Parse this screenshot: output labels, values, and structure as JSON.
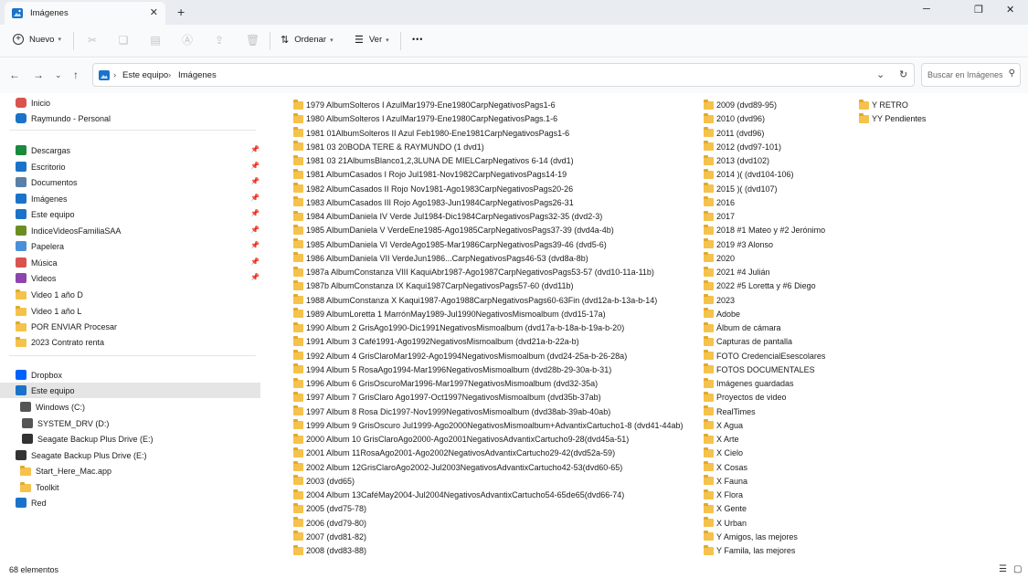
{
  "window": {
    "tab_title": "Imágenes",
    "tab_close": "✕",
    "new_tab": "+",
    "minimize": "─",
    "maximize": "❐",
    "close": "✕"
  },
  "toolbar": {
    "new_label": "Nuevo",
    "sort_label": "Ordenar",
    "view_label": "Ver",
    "more": "•••"
  },
  "address": {
    "crumbs": [
      "Este equipo",
      "Imágenes"
    ],
    "separator": "›",
    "search_placeholder": "Buscar en Imágenes"
  },
  "sidebar": {
    "items": [
      {
        "label": "Inicio",
        "icon": "home-icon"
      },
      {
        "label": "Raymundo - Personal",
        "icon": "cloud-icon"
      },
      {
        "label": "Descargas",
        "icon": "download-icon",
        "pinned": true
      },
      {
        "label": "Escritorio",
        "icon": "desktop-icon",
        "pinned": true
      },
      {
        "label": "Documentos",
        "icon": "documents-icon",
        "pinned": true
      },
      {
        "label": "Imágenes",
        "icon": "pictures-icon",
        "pinned": true
      },
      {
        "label": "Este equipo",
        "icon": "computer-icon",
        "pinned": true
      },
      {
        "label": "IndiceVideosFamiliaSAA",
        "icon": "app-icon",
        "pinned": true
      },
      {
        "label": "Papelera",
        "icon": "recycle-bin-icon",
        "pinned": true
      },
      {
        "label": "Música",
        "icon": "music-icon",
        "pinned": true
      },
      {
        "label": "Videos",
        "icon": "videos-icon",
        "pinned": true
      },
      {
        "label": "Video 1 año D",
        "icon": "folder-icon"
      },
      {
        "label": "Video 1 año L",
        "icon": "folder-icon"
      },
      {
        "label": "POR ENVIAR Procesar",
        "icon": "folder-icon"
      },
      {
        "label": "2023 Contrato renta",
        "icon": "folder-icon"
      },
      {
        "label": "Dropbox",
        "icon": "dropbox-icon"
      },
      {
        "label": "Este equipo",
        "icon": "computer-icon",
        "selected": true
      },
      {
        "label": "Windows (C:)",
        "icon": "drive-icon"
      },
      {
        "label": "SYSTEM_DRV (D:)",
        "icon": "drive-icon"
      },
      {
        "label": "Seagate Backup Plus Drive (E:)",
        "icon": "usb-drive-icon"
      },
      {
        "label": "Seagate Backup Plus Drive (E:)",
        "icon": "usb-drive-icon"
      },
      {
        "label": "Start_Here_Mac.app",
        "icon": "folder-icon"
      },
      {
        "label": "Toolkit",
        "icon": "folder-icon"
      },
      {
        "label": "Red",
        "icon": "network-icon"
      }
    ]
  },
  "content": {
    "columns": [
      [
        "1979 AlbumSolteros I AzulMar1979-Ene1980CarpNegativosPags1-6",
        "1980 AlbumSolteros I AzulMar1979-Ene1980CarpNegativosPags.1-6",
        "1981 01AlbumSolteros II Azul Feb1980-Ene1981CarpNegativosPags1-6",
        "1981 03 20BODA TERE & RAYMUNDO (1 dvd1)",
        "1981 03 21AlbumsBlanco1,2,3LUNA DE MIELCarpNegativos 6-14 (dvd1)",
        "1981 AlbumCasados I Rojo Jul1981-Nov1982CarpNegativosPags14-19",
        "1982 AlbumCasados II Rojo Nov1981-Ago1983CarpNegativosPags20-26",
        "1983 AlbumCasados III Rojo Ago1983-Jun1984CarpNegativosPags26-31",
        "1984 AlbumDaniela IV Verde Jul1984-Dic1984CarpNegativosPags32-35 (dvd2-3)",
        "1985 AlbumDaniela V VerdeEne1985-Ago1985CarpNegativosPags37-39 (dvd4a-4b)",
        "1985 AlbumDaniela VI VerdeAgo1985-Mar1986CarpNegativosPags39-46 (dvd5-6)",
        "1986 AlbumDaniela VII VerdeJun1986...CarpNegativosPags46-53 (dvd8a-8b)",
        "1987a AlbumConstanza VIII KaquiAbr1987-Ago1987CarpNegativosPags53-57 (dvd10-11a-11b)",
        "1987b AlbumConstanza IX Kaqui1987CarpNegativosPags57-60 (dvd11b)",
        "1988 AlbumConstanza X Kaqui1987-Ago1988CarpNegativosPags60-63Fin (dvd12a-b-13a-b-14)",
        "1989 AlbumLoretta 1 MarrónMay1989-Jul1990NegativosMismoalbum (dvd15-17a)",
        "1990 Album 2 GrisAgo1990-Dic1991NegativosMismoalbum (dvd17a-b-18a-b-19a-b-20)",
        "1991 Album 3 Café1991-Ago1992NegativosMismoalbum (dvd21a-b-22a-b)",
        "1992 Album 4 GrisClaroMar1992-Ago1994NegativosMismoalbum (dvd24-25a-b-26-28a)",
        "1994 Album 5 RosaAgo1994-Mar1996NegativosMismoalbum (dvd28b-29-30a-b-31)",
        "1996 Album 6 GrisOscuroMar1996-Mar1997NegativosMismoalbum (dvd32-35a)",
        "1997 Album 7 GrisClaro Ago1997-Oct1997NegativosMismoalbum (dvd35b-37ab)",
        "1997 Album 8 Rosa Dic1997-Nov1999NegativosMismoalbum (dvd38ab-39ab-40ab)",
        "1999 Album 9 GrisOscuro Jul1999-Ago2000NegativosMismoalbum+AdvantixCartucho1-8 (dvd41-44ab)",
        "2000 Album 10 GrisClaroAgo2000-Ago2001NegativosAdvantixCartucho9-28(dvd45a-51)",
        "2001 Album 11RosaAgo2001-Ago2002NegativosAdvantixCartucho29-42(dvd52a-59)",
        "2002 Album 12GrisClaroAgo2002-Jul2003NegativosAdvantixCartucho42-53(dvd60-65)",
        "2003 (dvd65)",
        "2004 Album 13CaféMay2004-Jul2004NegativosAdvantixCartucho54-65de65(dvd66-74)",
        "2005 (dvd75-78)",
        "2006 (dvd79-80)",
        "2007 (dvd81-82)",
        "2008 (dvd83-88)"
      ],
      [
        "2009 (dvd89-95)",
        "2010 (dvd96)",
        "2011 (dvd96)",
        "2012 (dvd97-101)",
        "2013 (dvd102)",
        "2014 )( (dvd104-106)",
        "2015 )( (dvd107)",
        "2016",
        "2017",
        "2018    #1 Mateo y #2 Jerónimo",
        "2019    #3 Alonso",
        "2020",
        "2021    #4 Julián",
        "2022    #5 Loretta y #6 Diego",
        "2023",
        "Adobe",
        "Álbum de cámara",
        "Capturas de pantalla",
        "FOTO CredencialEsescolares",
        "FOTOS DOCUMENTALES",
        "Imágenes guardadas",
        "Proyectos de video",
        "RealTimes",
        "X Agua",
        "X Arte",
        "X Cielo",
        "X Cosas",
        "X Fauna",
        "X Flora",
        "X Gente",
        "X Urban",
        "Y Amigos, las mejores",
        "Y Famila, las mejores"
      ],
      [
        "Y RETRO",
        "YY Pendientes"
      ]
    ]
  },
  "status": {
    "count": "68 elementos"
  },
  "colors": {
    "folder": "#f5c24b",
    "selected": "#e5e5e5",
    "accent": "#0067c0"
  }
}
